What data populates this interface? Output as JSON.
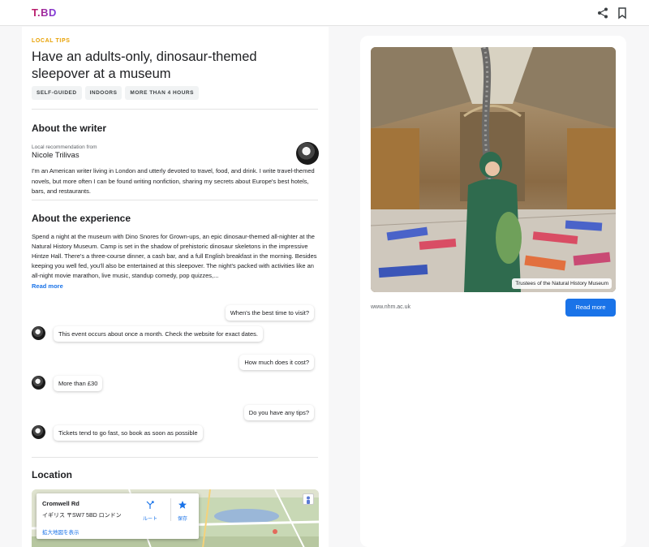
{
  "header": {
    "logo": "T.BD",
    "share_icon": "share-icon",
    "bookmark_icon": "bookmark-icon"
  },
  "article": {
    "eyebrow": "LOCAL TIPS",
    "title": "Have an adults-only, dinosaur-themed sleepover at a museum",
    "tags": [
      "SELF-GUIDED",
      "INDOORS",
      "MORE THAN 4 HOURS"
    ]
  },
  "writer": {
    "heading": "About the writer",
    "label": "Local recommendation from",
    "name": "Nicole Trilivas",
    "bio": "I'm an American writer living in London and utterly devoted to travel, food, and drink. I write travel-themed novels, but more often I can be found writing nonfiction, sharing my secrets about Europe's best hotels, bars, and restaurants."
  },
  "experience": {
    "heading": "About the experience",
    "text": "Spend a night at the museum with Dino Snores for Grown-ups, an epic dinosaur-themed all-nighter at the Natural History Museum. Camp is set in the shadow of prehistoric dinosaur skeletons in the impressive Hintze Hall. There's a three-course dinner, a cash bar, and a full English breakfast in the morning. Besides keeping you well fed, you'll also be entertained at this sleepover. The night's packed with activities like an all-night movie marathon, live music, standup comedy, pop quizzes,...",
    "read_more": "Read more"
  },
  "qa": [
    {
      "q": "When's the best time to visit?",
      "a": "This event occurs about once a month. Check the website for exact dates."
    },
    {
      "q": "How much does it cost?",
      "a": "More than £30"
    },
    {
      "q": "Do you have any tips?",
      "a": "Tickets tend to go fast, so book as soon as possible"
    }
  ],
  "location": {
    "heading": "Location",
    "place": "Cromwell Rd",
    "address": "イギリス 〒SW7 5BD ロンドン",
    "route": "ルート",
    "save": "保存",
    "larger_map": "拡大地図を表示"
  },
  "sidebar": {
    "photo_credit": "Trustees of the Natural History Museum",
    "url": "www.nhm.ac.uk",
    "button": "Read more"
  },
  "colors": {
    "accent": "#1a73e8",
    "eyebrow": "#e8a000"
  }
}
